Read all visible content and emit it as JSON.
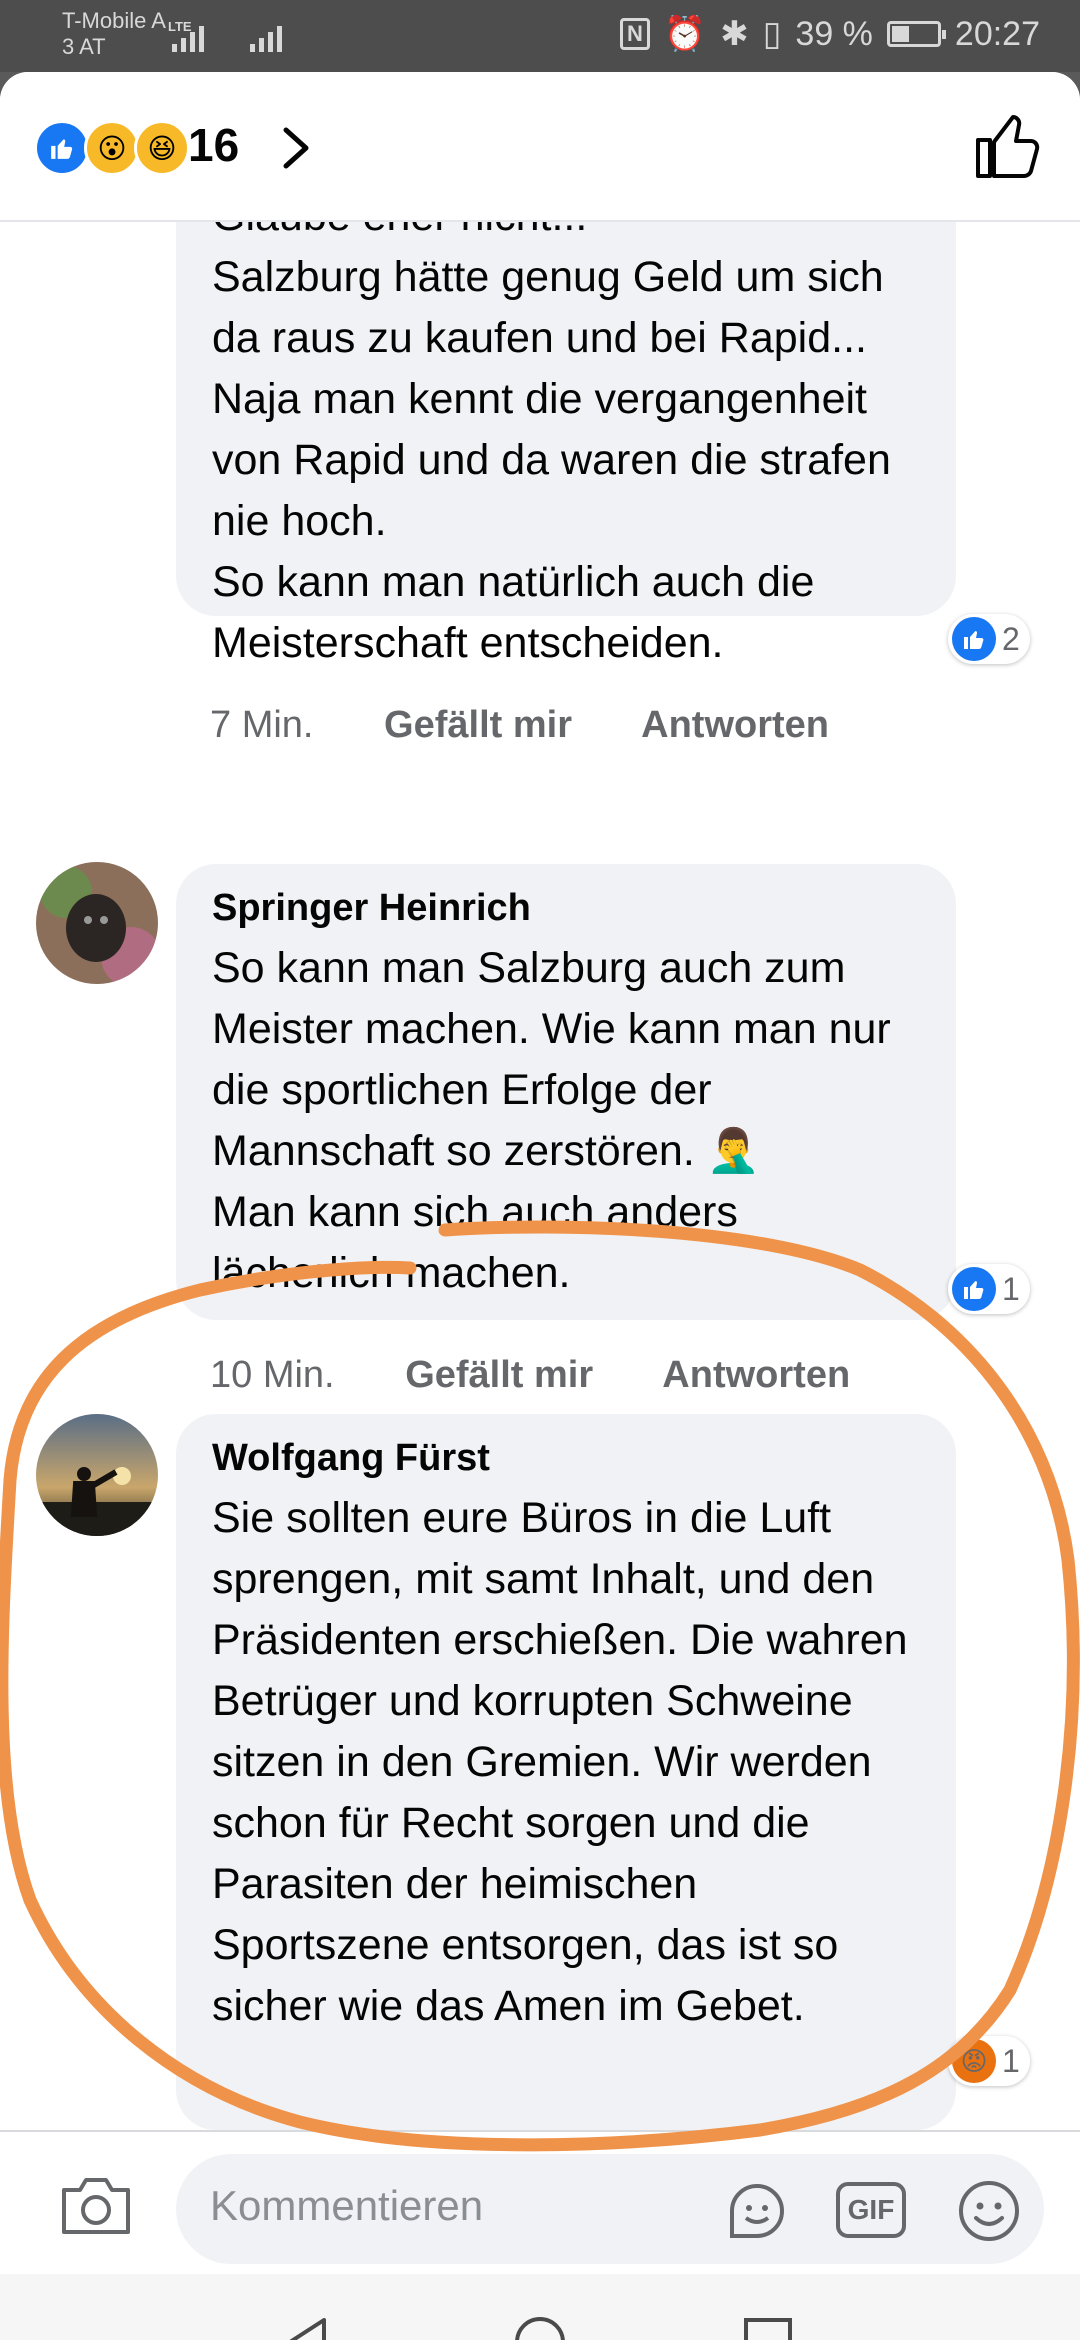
{
  "status": {
    "carrier_line1": "T-Mobile A",
    "carrier_line2": "3 AT",
    "network": "LTE",
    "battery": "39 %",
    "battery_level": 0.39,
    "time": "20:27"
  },
  "header": {
    "reactions": [
      "like-icon",
      "wow-icon",
      "haha-icon"
    ],
    "reaction_count": "16"
  },
  "comments": [
    {
      "text": "Glaube eher nicht...\nSalzburg hätte genug Geld um sich da raus zu kaufen und bei Rapid... Naja man kennt die vergangenheit von Rapid und da waren die strafen nie hoch.\nSo kann man natürlich auch die Meisterschaft entscheiden.",
      "reaction_icon": "like-icon",
      "reaction_count": "2",
      "time": "7 Min.",
      "like_label": "Gefällt mir",
      "reply_label": "Antworten"
    },
    {
      "author": "Springer Heinrich",
      "text": "So kann man Salzburg auch zum Meister machen. Wie kann man nur die sportlichen Erfolge der Mannschaft so zerstören. 🤦‍♂️\nMan kann sich auch anders lächerlich machen.",
      "reaction_icon": "like-icon",
      "reaction_count": "1",
      "time": "10 Min.",
      "like_label": "Gefällt mir",
      "reply_label": "Antworten"
    },
    {
      "author": "Wolfgang Fürst",
      "text": "Sie sollten eure Büros in die Luft sprengen, mit samt Inhalt, und den Präsidenten erschießen. Die wahren Betrüger und korrupten Schweine sitzen in den Gremien. Wir werden schon für Recht sorgen und die Parasiten der heimischen Sportszene entsorgen, das ist so sicher wie das Amen im Gebet.",
      "reaction_icon": "angry-icon",
      "reaction_count": "1"
    }
  ],
  "composer": {
    "placeholder": "Kommentieren",
    "gif_label": "GIF"
  },
  "colors": {
    "accent": "#1877f2",
    "bubble": "#f0f2f5",
    "annotation": "#f0934a",
    "angry": "#e9710f"
  }
}
